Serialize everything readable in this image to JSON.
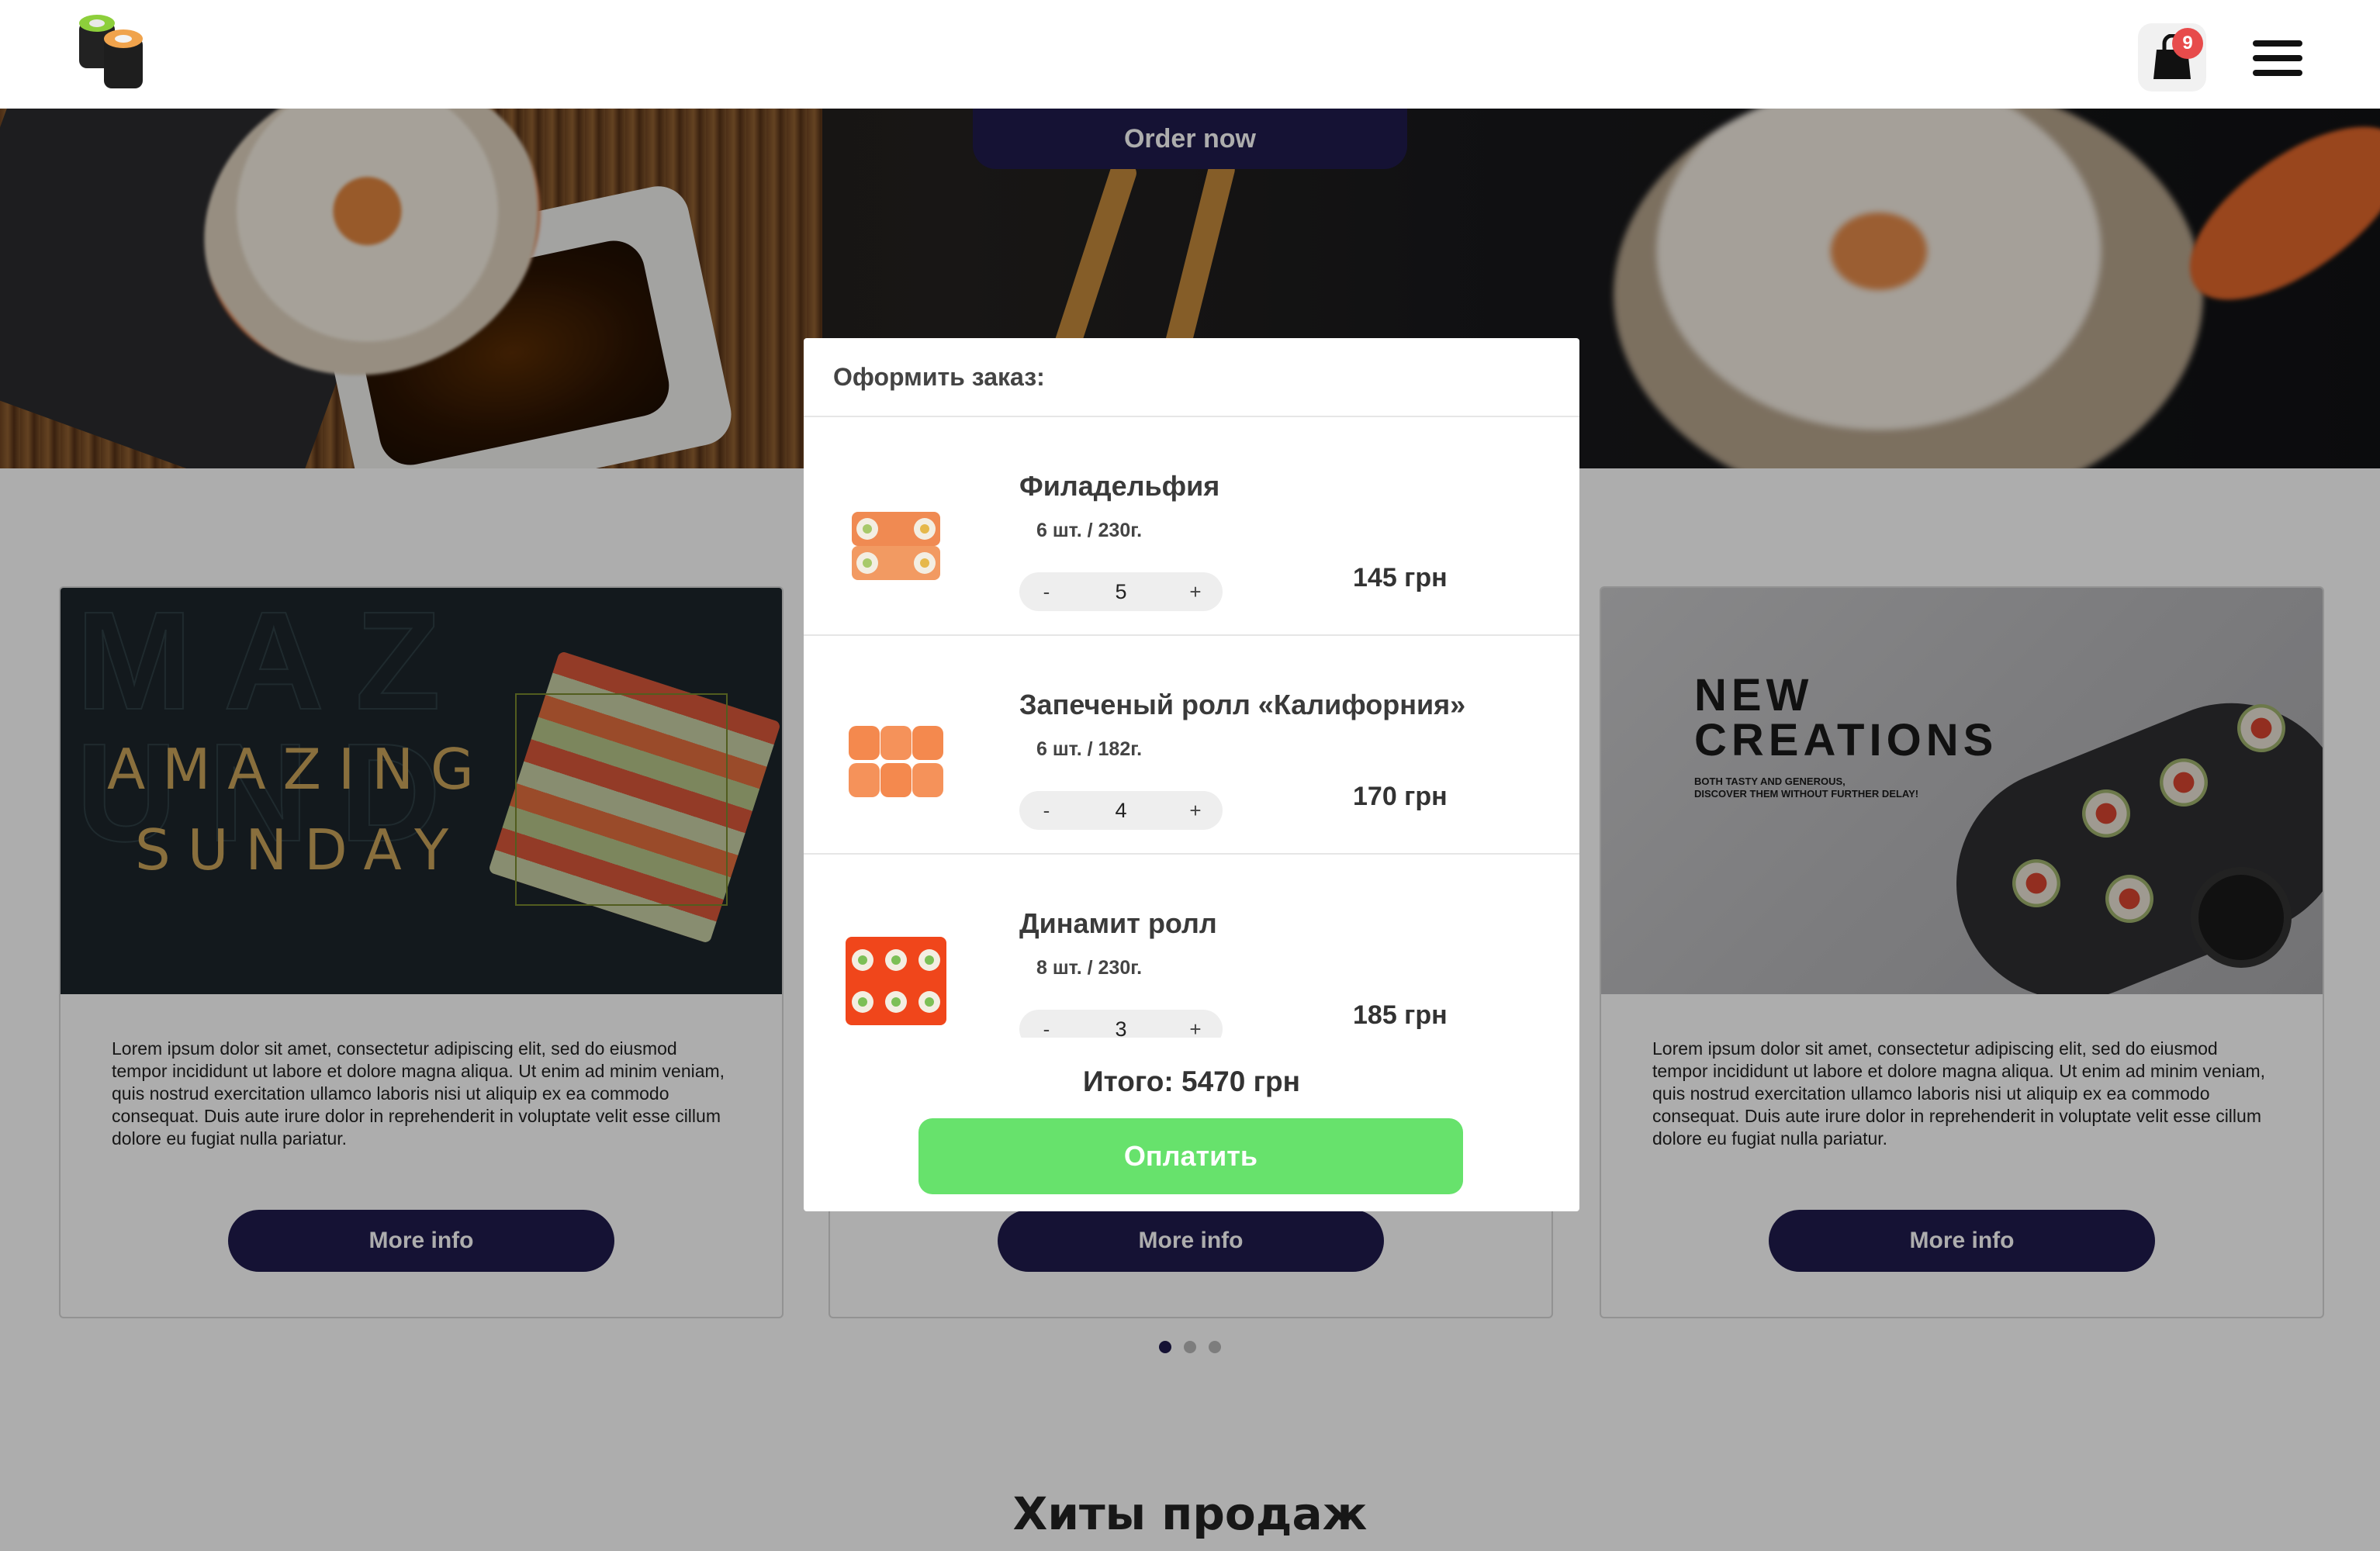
{
  "header": {
    "logo_icon": "sushi-rolls-logo",
    "cart_icon": "shopping-bag-icon",
    "cart_count": "9",
    "menu_icon": "hamburger-menu-icon"
  },
  "hero": {
    "order_button": "Order now"
  },
  "cards": [
    {
      "banner_title_line1": "AMAZING",
      "banner_title_line2": "SUNDAY",
      "text": "Lorem ipsum dolor sit amet, consectetur adipiscing elit, sed do eiusmod tempor incididunt ut labore et dolore magna aliqua. Ut enim ad minim veniam, quis nostrud exercitation ullamco laboris nisi ut aliquip ex ea commodo consequat. Duis aute irure dolor in reprehenderit in voluptate velit esse cillum dolore eu fugiat nulla pariatur.",
      "button": "More info"
    },
    {
      "button": "More info"
    },
    {
      "banner_title_line1": "NEW",
      "banner_title_line2": "CREATIONS",
      "banner_sub_line1": "BOTH TASTY AND GENEROUS,",
      "banner_sub_line2": "DISCOVER THEM WITHOUT FURTHER DELAY!",
      "text": "Lorem ipsum dolor sit amet, consectetur adipiscing elit, sed do eiusmod tempor incididunt ut labore et dolore magna aliqua. Ut enim ad minim veniam, quis nostrud exercitation ullamco laboris nisi ut aliquip ex ea commodo consequat. Duis aute irure dolor in reprehenderit in voluptate velit esse cillum dolore eu fugiat nulla pariatur.",
      "button": "More info"
    }
  ],
  "carousel": {
    "slides": 3,
    "active": 1
  },
  "section_title": "Хиты продаж",
  "modal": {
    "title": "Оформить заказ:",
    "items": [
      {
        "name": "Филадельфия",
        "meta": "6 шт. / 230г.",
        "qty": "5",
        "price": "145 грн",
        "minus": "-",
        "plus": "+"
      },
      {
        "name": "Запеченый ролл «Калифорния»",
        "meta": "6 шт. / 182г.",
        "qty": "4",
        "price": "170 грн",
        "minus": "-",
        "plus": "+"
      },
      {
        "name": "Динамит ролл",
        "meta": "8 шт. / 230г.",
        "qty": "3",
        "price": "185 грн",
        "minus": "-",
        "plus": "+"
      }
    ],
    "total": "Итого: 5470 грн",
    "pay_button": "Оплатить"
  },
  "colors": {
    "accent_navy": "#1f1b4d",
    "pay_green": "#67e26c",
    "badge_red": "#e74b4b",
    "overlay": "rgba(0,0,0,0.32)"
  }
}
